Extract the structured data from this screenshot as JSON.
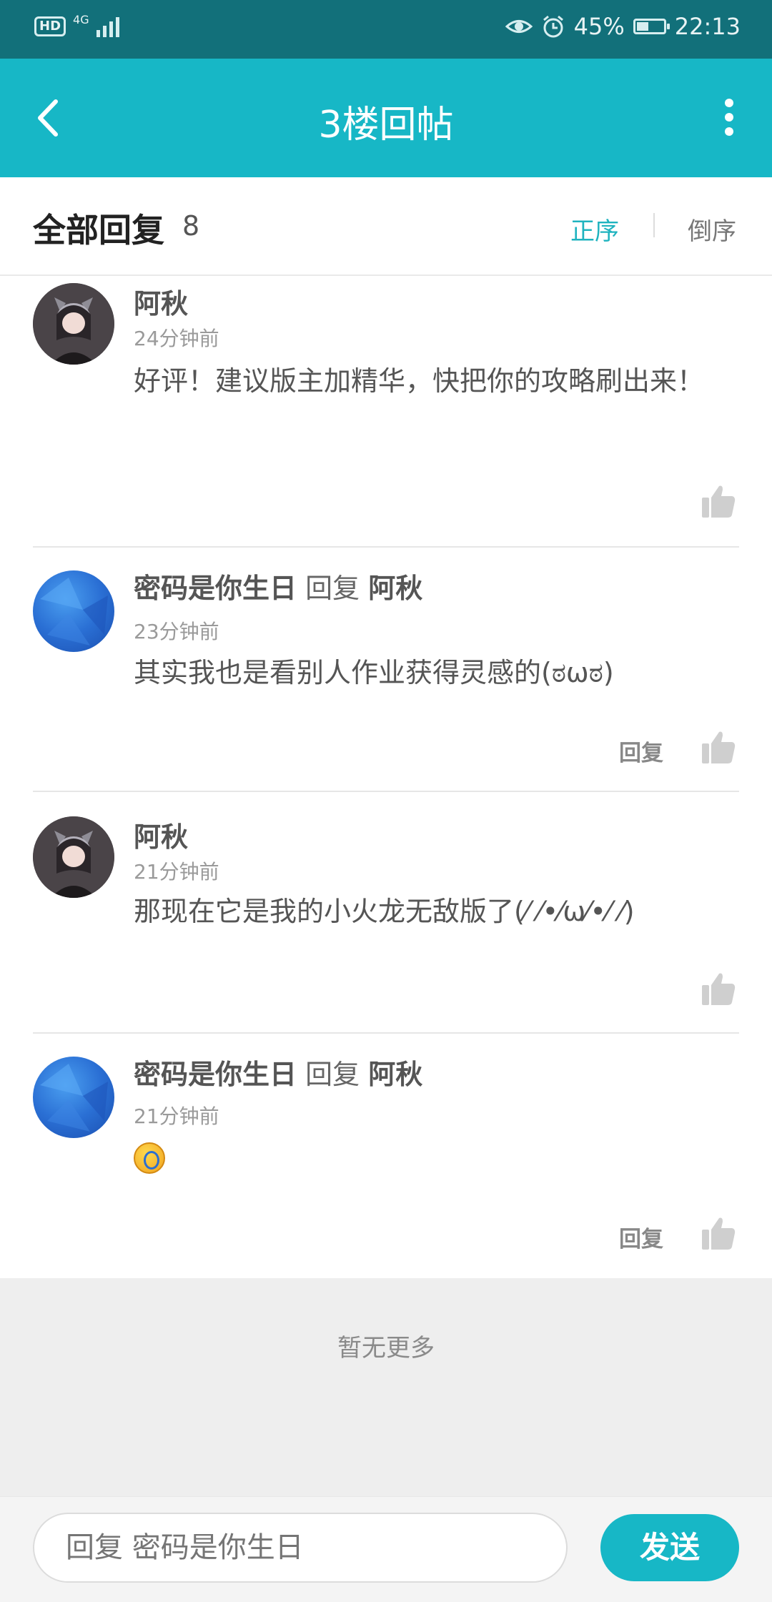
{
  "status_bar": {
    "hd": "HD",
    "network": "4G",
    "battery_percent": "45%",
    "battery_level": 0.45,
    "time": "22:13",
    "icons": [
      "eye-icon",
      "alarm-icon",
      "battery-icon",
      "signal-icon"
    ]
  },
  "header": {
    "title": "3楼回帖"
  },
  "section": {
    "title": "全部回复",
    "count": "8",
    "sort_asc": "正序",
    "sort_desc": "倒序"
  },
  "comments": [
    {
      "author": "阿秋",
      "time": "24分钟前",
      "text": "好评！建议版主加精华，快把你的攻略刷出来！",
      "avatar": "anime-avatar"
    },
    {
      "author": "密码是你生日",
      "reply_word": "回复",
      "reply_to": "阿秋",
      "time": "23分钟前",
      "text": "其实我也是看别人作业获得灵感的(ಠωಠ)",
      "reply_label": "回复",
      "avatar": "blue-avatar"
    },
    {
      "author": "阿秋",
      "time": "21分钟前",
      "text": "那现在它是我的小火龙无敌版了(⁄ ⁄•⁄ω⁄•⁄ ⁄)",
      "avatar": "anime-avatar"
    },
    {
      "author": "密码是你生日",
      "reply_word": "回复",
      "reply_to": "阿秋",
      "time": "21分钟前",
      "emoji": "laugh-emoji",
      "reply_label": "回复",
      "avatar": "blue-avatar"
    }
  ],
  "footer": {
    "no_more": "暂无更多"
  },
  "input_bar": {
    "placeholder": "回复 密码是你生日",
    "send": "发送"
  },
  "colors": {
    "status_bar": "#12707a",
    "header": "#17b7c6",
    "accent": "#1fb3bf"
  }
}
